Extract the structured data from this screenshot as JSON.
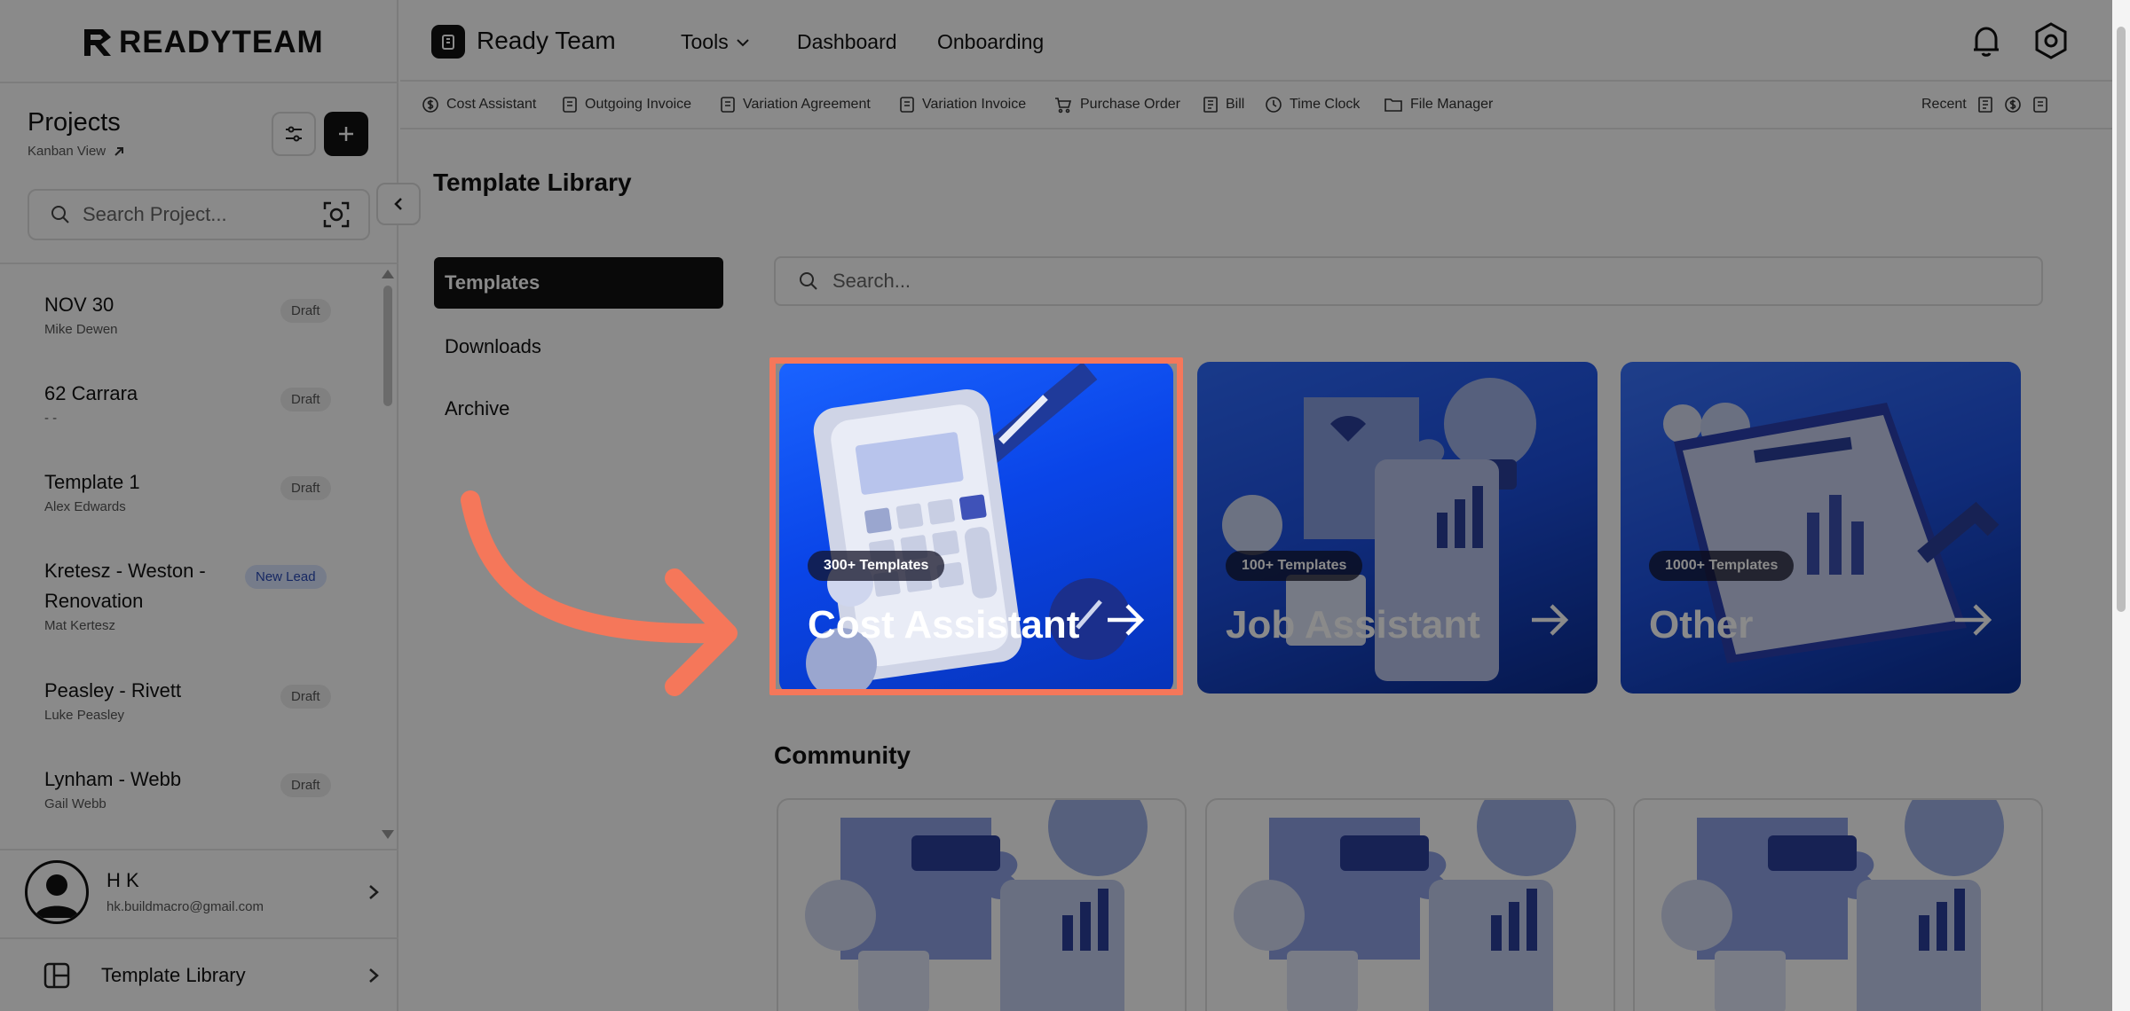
{
  "brand": {
    "name": "READYTEAM"
  },
  "sidebar": {
    "title": "Projects",
    "view_link": "Kanban View",
    "search_placeholder": "Search Project...",
    "projects": [
      {
        "name": "NOV 30",
        "owner": "Mike Dewen",
        "status": "Draft"
      },
      {
        "name": "62 Carrara",
        "owner": "- -",
        "status": "Draft"
      },
      {
        "name": "Template 1",
        "owner": "Alex Edwards",
        "status": "Draft"
      },
      {
        "name": "Kretesz - Weston - Renovation",
        "owner": "Mat Kertesz",
        "status": "New Lead"
      },
      {
        "name": "Peasley - Rivett",
        "owner": "Luke Peasley",
        "status": "Draft"
      },
      {
        "name": "Lynham - Webb",
        "owner": "Gail Webb",
        "status": "Draft"
      }
    ],
    "user": {
      "initials": "H K",
      "email": "hk.buildmacro@gmail.com"
    },
    "bottom_link": "Template Library"
  },
  "topbar": {
    "app_name": "Ready Team",
    "nav": [
      "Tools",
      "Dashboard",
      "Onboarding"
    ]
  },
  "quickbar": {
    "items": [
      "Cost Assistant",
      "Outgoing Invoice",
      "Variation Agreement",
      "Variation Invoice",
      "Purchase Order",
      "Bill",
      "Time Clock",
      "File Manager"
    ],
    "recent_label": "Recent"
  },
  "main": {
    "title": "Template Library",
    "subnav": [
      "Templates",
      "Downloads",
      "Archive"
    ],
    "search_placeholder": "Search...",
    "cards": [
      {
        "name": "Cost Assistant",
        "count": "300+ Templates"
      },
      {
        "name": "Job Assistant",
        "count": "100+ Templates"
      },
      {
        "name": "Other",
        "count": "1000+ Templates"
      }
    ],
    "community_title": "Community"
  },
  "colors": {
    "highlight": "#f5775a",
    "card_blue": "#0a45e8",
    "overlay": "rgba(0,0,0,0.46)"
  }
}
